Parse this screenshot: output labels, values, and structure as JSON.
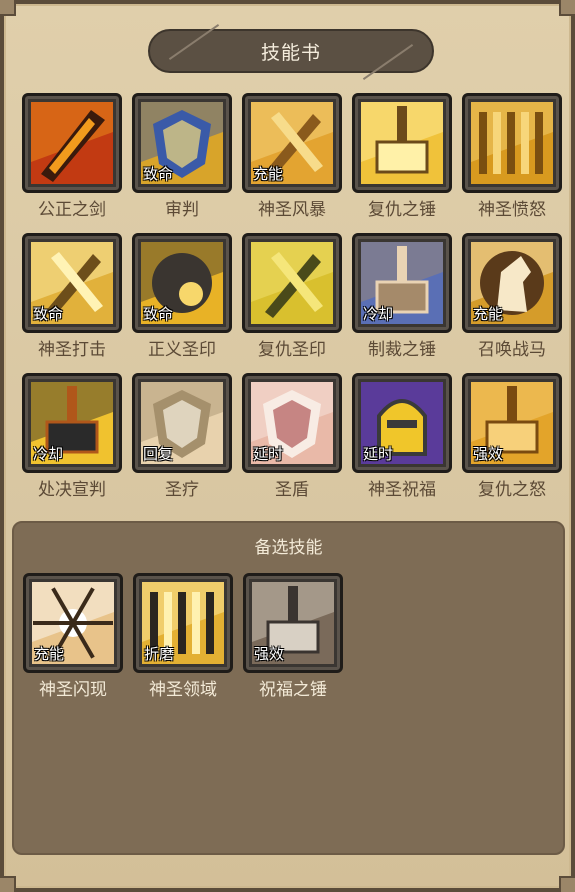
{
  "header": {
    "title": "技能书"
  },
  "skills": [
    {
      "name": "公正之剑",
      "tag": "",
      "icon": "flaming-blade-icon",
      "colors": [
        "#c23a12",
        "#f29b1d",
        "#3a1a0c"
      ]
    },
    {
      "name": "审判",
      "tag": "致命",
      "icon": "judgment-shield-icon",
      "colors": [
        "#d8a42a",
        "#3a5aa8",
        "#f5dc7a"
      ]
    },
    {
      "name": "神圣风暴",
      "tag": "充能",
      "icon": "holy-storm-sword-icon",
      "colors": [
        "#e3a431",
        "#f7dc8b",
        "#8a5a1c"
      ]
    },
    {
      "name": "复仇之锤",
      "tag": "",
      "icon": "vengeance-hammer-icon",
      "colors": [
        "#f0c23a",
        "#fff1a8",
        "#6b4a1a"
      ]
    },
    {
      "name": "神圣愤怒",
      "tag": "",
      "icon": "holy-wrath-pillar-icon",
      "colors": [
        "#d89a1f",
        "#f7d67a",
        "#7a4f10"
      ]
    },
    {
      "name": "神圣打击",
      "tag": "致命",
      "icon": "holy-strike-icon",
      "colors": [
        "#e1b13b",
        "#fff3b5",
        "#6d4e1a"
      ]
    },
    {
      "name": "正义圣印",
      "tag": "致命",
      "icon": "justice-seal-icon",
      "colors": [
        "#e8b226",
        "#3a3530",
        "#f7d76b"
      ]
    },
    {
      "name": "复仇圣印",
      "tag": "",
      "icon": "vengeance-seal-icon",
      "colors": [
        "#d9c02e",
        "#f5e67a",
        "#4a4a1a"
      ]
    },
    {
      "name": "制裁之锤",
      "tag": "冷却",
      "icon": "sanction-hammer-icon",
      "colors": [
        "#5a6fb5",
        "#a58a6a",
        "#e9d3b4"
      ]
    },
    {
      "name": "召唤战马",
      "tag": "充能",
      "icon": "warhorse-icon",
      "colors": [
        "#d59c2a",
        "#f7e8c8",
        "#5a3a1a"
      ]
    },
    {
      "name": "处决宣判",
      "tag": "冷却",
      "icon": "execution-hammer-icon",
      "colors": [
        "#f0c22f",
        "#2a2a2a",
        "#b0571a"
      ]
    },
    {
      "name": "圣疗",
      "tag": "回复",
      "icon": "lay-on-hands-icon",
      "colors": [
        "#e8d2ad",
        "#a5906c",
        "#f8f1e1"
      ]
    },
    {
      "name": "圣盾",
      "tag": "延时",
      "icon": "divine-shield-icon",
      "colors": [
        "#e9b9a8",
        "#f8ece4",
        "#b05a5a"
      ]
    },
    {
      "name": "神圣祝福",
      "tag": "延时",
      "icon": "blessing-helmet-icon",
      "colors": [
        "#f0c62a",
        "#5a3b9a",
        "#3a3a3a"
      ]
    },
    {
      "name": "复仇之怒",
      "tag": "强效",
      "icon": "avenging-wrath-icon",
      "colors": [
        "#e3a42a",
        "#f7d07a",
        "#7a4a10"
      ]
    }
  ],
  "alternate": {
    "title": "备选技能",
    "skills": [
      {
        "name": "神圣闪现",
        "tag": "充能",
        "icon": "holy-flash-icon",
        "colors": [
          "#e8c38a",
          "#ffffff",
          "#3a2a1a"
        ]
      },
      {
        "name": "神圣领域",
        "tag": "折磨",
        "icon": "holy-domain-crown-icon",
        "colors": [
          "#e3b033",
          "#fff1b0",
          "#2a2520"
        ]
      },
      {
        "name": "祝福之锤",
        "tag": "强效",
        "icon": "blessed-hammer-icon",
        "colors": [
          "#7a6a5a",
          "#d8d0c4",
          "#3a3430"
        ]
      }
    ]
  }
}
